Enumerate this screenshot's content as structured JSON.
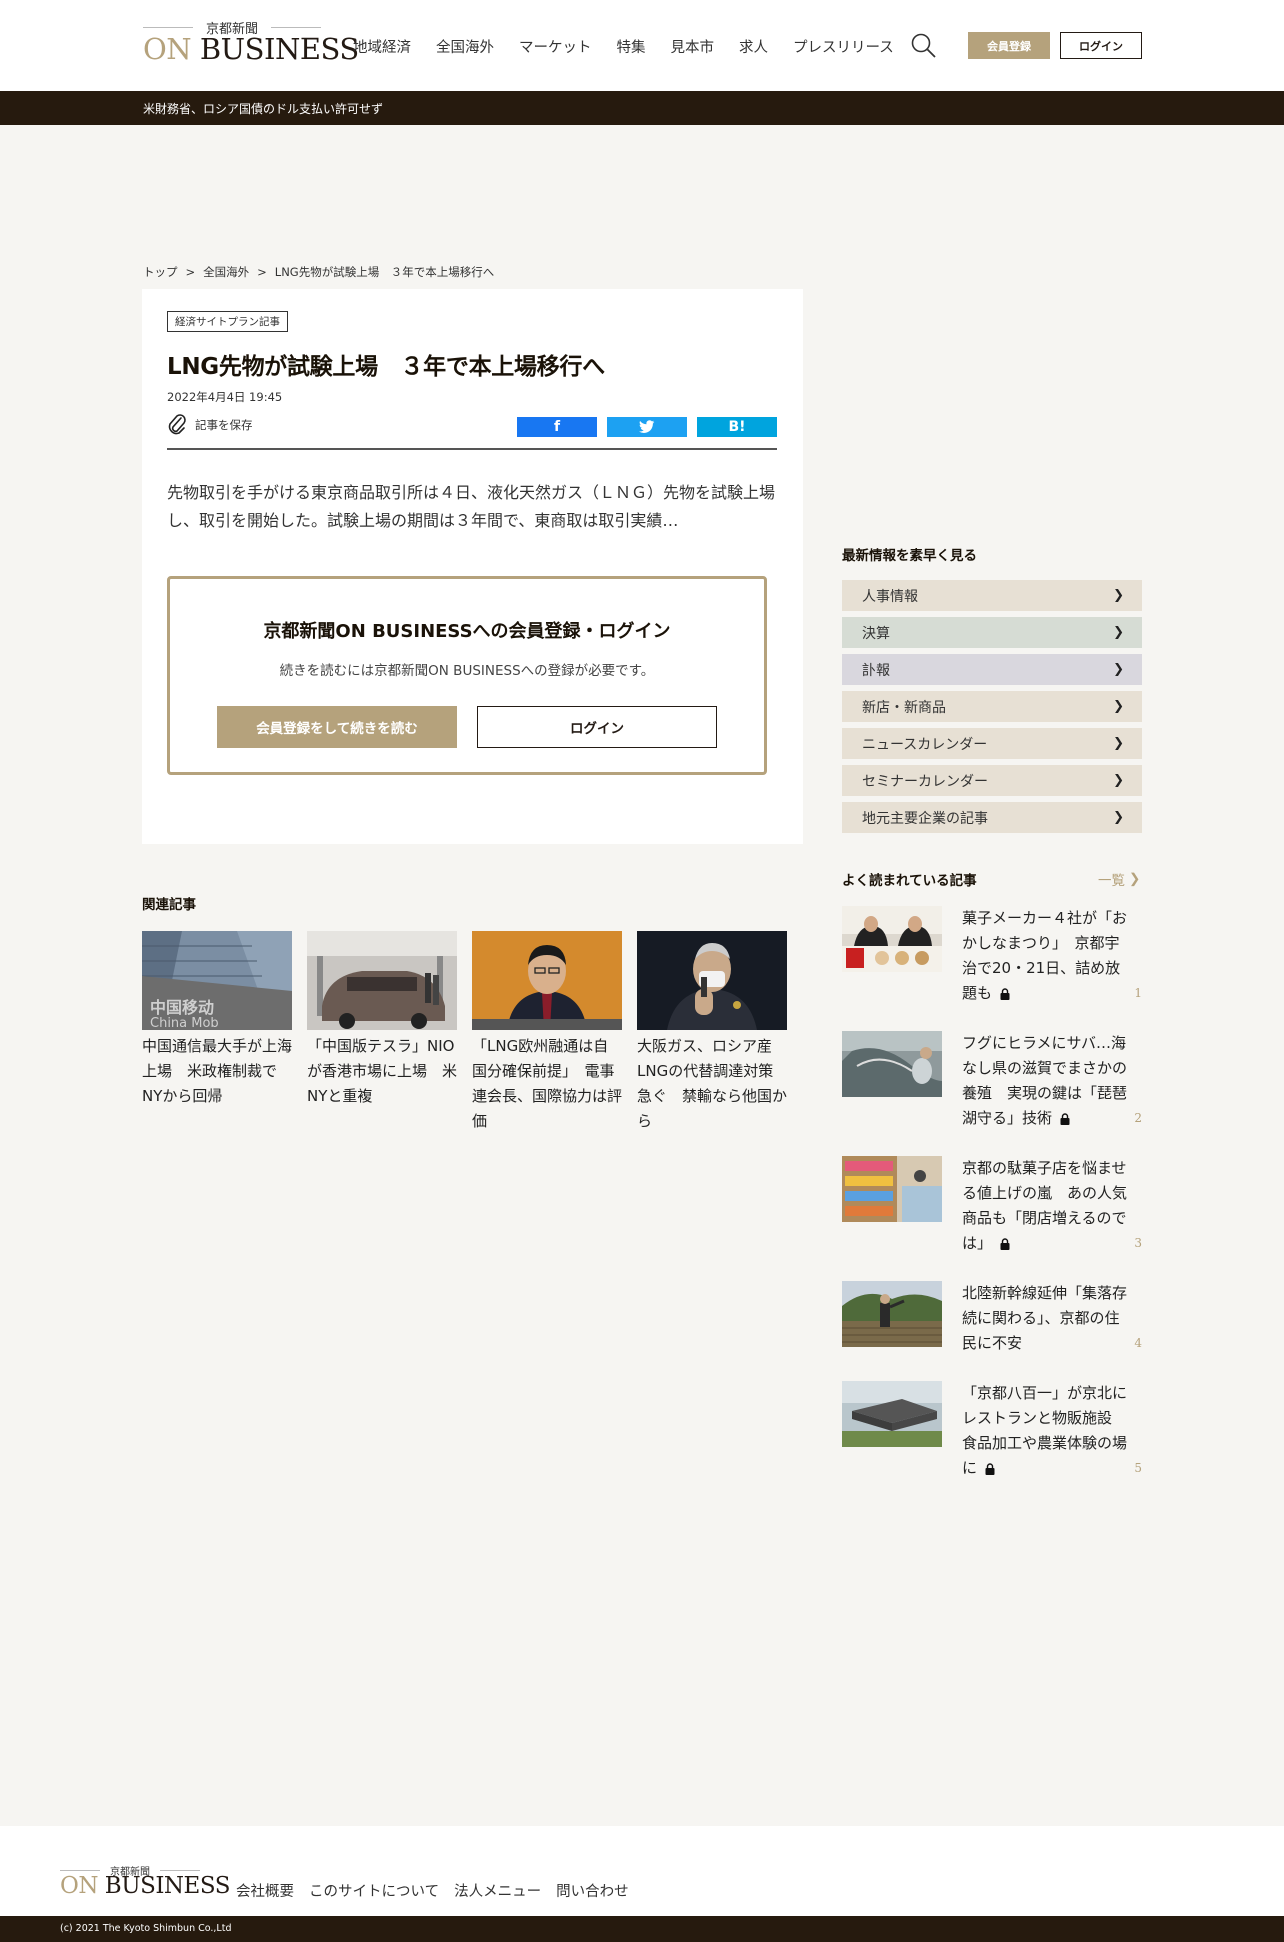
{
  "header": {
    "logo_small": "京都新聞",
    "logo_on": "ON",
    "logo_business": "BUSINESS",
    "nav": [
      "地域経済",
      "全国海外",
      "マーケット",
      "特集",
      "見本市",
      "求人",
      "プレスリリース"
    ],
    "register_label": "会員登録",
    "login_label": "ログイン"
  },
  "ticker": {
    "text": "米財務省、ロシア国債のドル支払い許可せず"
  },
  "breadcrumb": [
    "トップ",
    "全国海外",
    "LNG先物が試験上場　３年で本上場移行へ"
  ],
  "breadcrumb_sep": ">",
  "article": {
    "tag": "経済サイトプラン記事",
    "title": "LNG先物が試験上場　３年で本上場移行へ",
    "date": "2022年4月4日 19:45",
    "save_label": "記事を保存",
    "share": {
      "facebook": "f",
      "twitter": "twitter-bird",
      "hatena": "B!"
    },
    "lead": "先物取引を手がける東京商品取引所は４日、液化天然ガス（ＬＮＧ）先物を試験上場し、取引を開始した。試験上場の期間は３年間で、東商取は取引実績…",
    "member_box": {
      "heading": "京都新聞ON BUSINESSへの会員登録・ログイン",
      "text": "続きを読むには京都新聞ON BUSINESSへの登録が必要です。",
      "register_label": "会員登録をして続きを読む",
      "login_label": "ログイン"
    }
  },
  "related": {
    "heading": "関連記事",
    "items": [
      {
        "text": "中国通信最大手が上海上場　米政権制裁でNYから回帰",
        "img": "china-mobile-building"
      },
      {
        "text": "「中国版テスラ」NIOが香港市場に上場　米NYと重複",
        "img": "nio-car-showroom"
      },
      {
        "text": "「LNG欧州融通は自国分確保前提」　電事連会長、国際協力は評価",
        "img": "press-conference-man"
      },
      {
        "text": "大阪ガス、ロシア産LNGの代替調達対策急ぐ　禁輸なら他国から",
        "img": "man-with-mask-microphone"
      }
    ]
  },
  "sidebar": {
    "quick_heading": "最新情報を素早く見る",
    "menu": [
      {
        "label": "人事情報",
        "color": "#e7e0d4"
      },
      {
        "label": "決算",
        "color": "#d6dcd4"
      },
      {
        "label": "訃報",
        "color": "#d9d7de"
      },
      {
        "label": "新店・新商品",
        "color": "#e7e0d4"
      },
      {
        "label": "ニュースカレンダー",
        "color": "#e7e0d4"
      },
      {
        "label": "セミナーカレンダー",
        "color": "#e7e0d4"
      },
      {
        "label": "地元主要企業の記事",
        "color": "#e7e0d4"
      }
    ],
    "popular_heading": "よく読まれている記事",
    "popular_more": "一覧",
    "popular": [
      {
        "text": "菓子メーカー４社が「おかしなまつり」　京都宇治で20・21日、詰め放題も",
        "locked": true,
        "rank": "1",
        "img": "two-men-sweets"
      },
      {
        "text": "フグにヒラメにサバ…海なし県の滋賀でまさかの養殖　実現の鍵は「琵琶湖守る」技術",
        "locked": true,
        "rank": "2",
        "img": "fish-tank"
      },
      {
        "text": "京都の駄菓子店を悩ませる値上げの嵐　あの人気商品も「閉店増えるのでは」",
        "locked": true,
        "rank": "3",
        "img": "candy-shop"
      },
      {
        "text": "北陸新幹線延伸「集落存続に関わる」、京都の住民に不安",
        "locked": false,
        "rank": "4",
        "img": "rural-landscape"
      },
      {
        "text": "「京都八百一」が京北にレストランと物販施設　食品加工や農業体験の場に",
        "locked": true,
        "rank": "5",
        "img": "building-rendering"
      }
    ]
  },
  "footer": {
    "logo_small": "京都新聞",
    "logo_on": "ON",
    "logo_business": "BUSINESS",
    "links": [
      "会社概要",
      "このサイトについて",
      "法人メニュー",
      "問い合わせ"
    ],
    "copyright": "(c) 2021 The Kyoto Shimbun Co.,Ltd"
  }
}
